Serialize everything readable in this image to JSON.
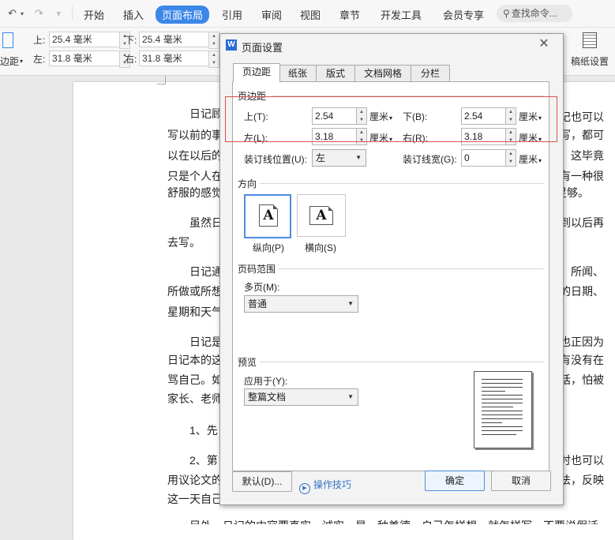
{
  "toolbar": {
    "tabs": [
      "开始",
      "插入",
      "页面布局",
      "引用",
      "审阅",
      "视图",
      "章节",
      "开发工具",
      "会员专享"
    ],
    "active_tab": "页面布局",
    "search_placeholder": "查找命令..."
  },
  "ribbon": {
    "margins_label": "边距",
    "top_label": "上:",
    "top_value": "25.4 毫米",
    "bottom_label": "下:",
    "bottom_value": "25.4 毫米",
    "left_label": "左:",
    "left_value": "31.8 毫米",
    "right_label": "右:",
    "right_value": "31.8 毫米",
    "manuscript_label": "稿纸设置"
  },
  "document": {
    "lines": [
      "日记顾",
      "写以前的事",
      "以在以后的",
      "只是个人在",
      "舒服的感觉",
      "虽然日",
      "去写。",
      "日记通",
      "所做或所想",
      "星期和天气",
      "日记是",
      "日记本的这",
      "骂自己。如",
      "家长、老师",
      "1、先",
      "2、第",
      "用议论文的",
      "这一天自己"
    ],
    "right_lines": [
      "记也可以",
      "写，都可",
      "，这毕竟",
      "有一种很",
      "足够。",
      "到以后再",
      "见、所闻、",
      "的日期、",
      "也正因为",
      "有没有在",
      "话，怕被",
      "时也可以",
      "法，反映"
    ],
    "bottom_line": "另外，日记的内容要真实，诚实，是一种美德，自己怎样想，就怎样写，不要说假话"
  },
  "dialog": {
    "title": "页面设置",
    "tabs": [
      "页边距",
      "纸张",
      "版式",
      "文档网格",
      "分栏"
    ],
    "selected_tab": "页边距",
    "margins_group": "页边距",
    "top_label": "上(T):",
    "top_value": "2.54",
    "bottom_label": "下(B):",
    "bottom_value": "2.54",
    "left_label": "左(L):",
    "left_value": "3.18",
    "right_label": "右(R):",
    "right_value": "3.18",
    "unit": "厘米",
    "gutter_pos_label": "装订线位置(U):",
    "gutter_pos_value": "左",
    "gutter_width_label": "装订线宽(G):",
    "gutter_width_value": "0",
    "orientation_group": "方向",
    "portrait_label": "纵向(P)",
    "landscape_label": "横向(S)",
    "pages_group": "页码范围",
    "multi_page_label": "多页(M):",
    "multi_page_value": "普通",
    "preview_group": "预览",
    "apply_to_label": "应用于(Y):",
    "apply_to_value": "整篇文档",
    "default_button": "默认(D)...",
    "tips_link": "操作技巧",
    "ok_button": "确定",
    "cancel_button": "取消"
  },
  "colors": {
    "accent": "#3c87e8",
    "highlight": "#d9534f"
  }
}
